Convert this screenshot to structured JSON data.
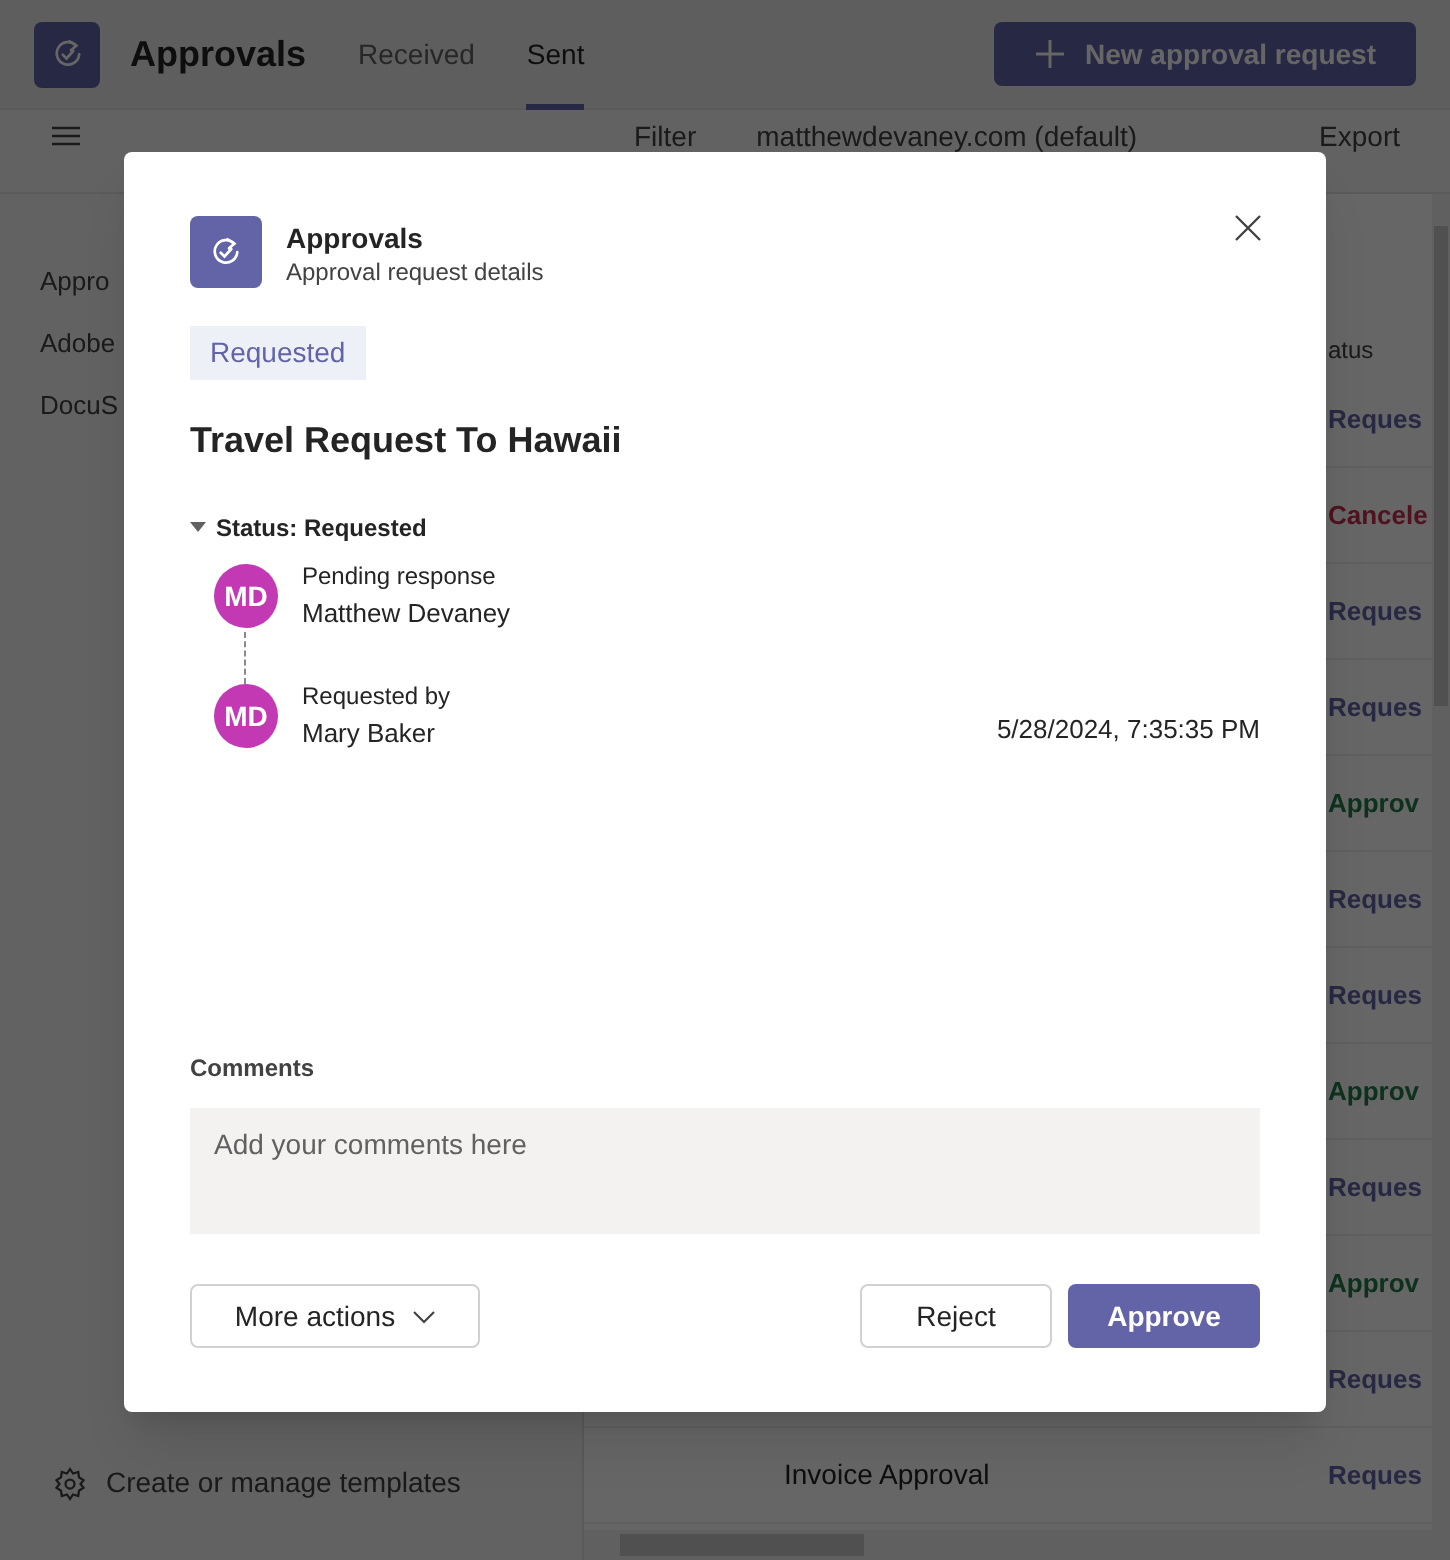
{
  "app": {
    "title": "Approvals",
    "tabs": [
      {
        "label": "Received",
        "selected": false
      },
      {
        "label": "Sent",
        "selected": true
      }
    ],
    "new_button": "New approval request"
  },
  "toolbar": {
    "filter": "Filter",
    "account": "matthewdevaney.com (default)",
    "export": "Export"
  },
  "sidebar": {
    "items": [
      {
        "label": "Appro"
      },
      {
        "label": "Adobe"
      },
      {
        "label": "DocuS"
      }
    ],
    "footer": "Create or manage templates"
  },
  "table": {
    "header": "atus",
    "rows": [
      {
        "status": "Reques",
        "kind": "requested"
      },
      {
        "status": "Cancele",
        "kind": "cancelled"
      },
      {
        "status": "Reques",
        "kind": "requested"
      },
      {
        "status": "Reques",
        "kind": "requested"
      },
      {
        "status": "Approv",
        "kind": "approved"
      },
      {
        "status": "Reques",
        "kind": "requested"
      },
      {
        "status": "Reques",
        "kind": "requested"
      },
      {
        "status": "Approv",
        "kind": "approved"
      },
      {
        "status": "Reques",
        "kind": "requested"
      },
      {
        "status": "Approv",
        "kind": "approved"
      },
      {
        "status": "Reques",
        "kind": "requested"
      },
      {
        "title": "Invoice Approval",
        "status": "Reques",
        "kind": "requested"
      }
    ]
  },
  "dialog": {
    "app_name": "Approvals",
    "subtitle": "Approval request details",
    "badge": "Requested",
    "title": "Travel Request To Hawaii",
    "status_heading": "Status: Requested",
    "status_expanded": true,
    "timeline": [
      {
        "initials": "MD",
        "label": "Pending response",
        "name": "Matthew Devaney",
        "color": "#c239b3"
      },
      {
        "initials": "MD",
        "label": "Requested by",
        "name": "Mary Baker",
        "time": "5/28/2024, 7:35:35 PM",
        "color": "#c239b3"
      }
    ],
    "comments_label": "Comments",
    "comments_placeholder": "Add your comments here",
    "buttons": [
      {
        "label": "More actions",
        "kind": "menu"
      },
      {
        "label": "Reject",
        "kind": "secondary"
      },
      {
        "label": "Approve",
        "kind": "primary"
      }
    ]
  }
}
